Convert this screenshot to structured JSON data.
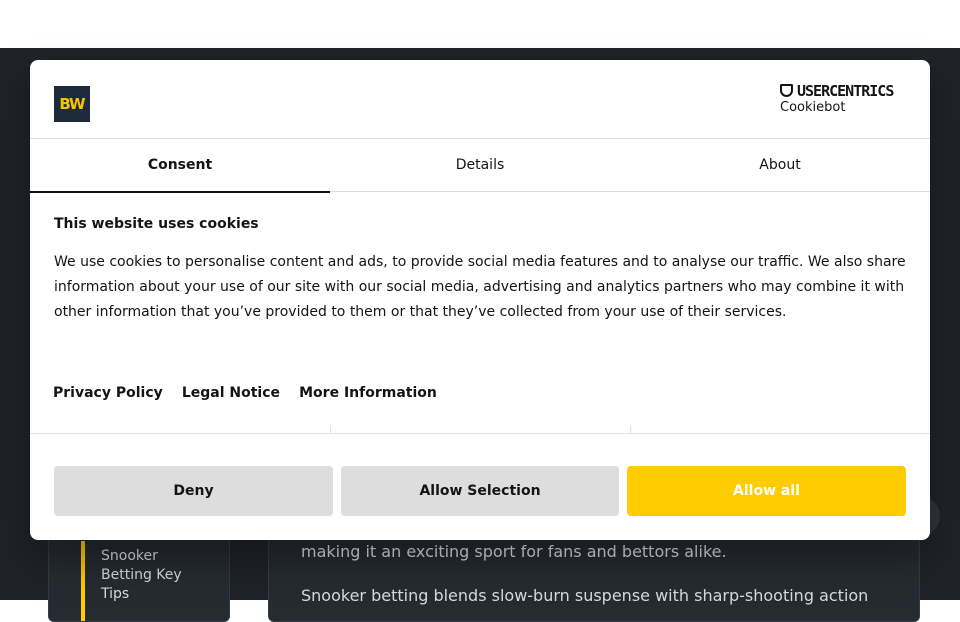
{
  "background": {
    "sidebar_link": "Snooker Betting Key Tips",
    "article_lines": [
      "making it an exciting sport for fans and bettors alike.",
      "Snooker betting blends slow-burn suspense with sharp-shooting action"
    ]
  },
  "dialog": {
    "logo_text": "BW",
    "brand": {
      "name": "USERCENTRICS",
      "sub": "Cookiebot"
    },
    "tabs": [
      {
        "label": "Consent"
      },
      {
        "label": "Details"
      },
      {
        "label": "About"
      }
    ],
    "title": "This website uses cookies",
    "body": "We use cookies to personalise content and ads, to provide social media features and to analyse our traffic. We also share information about your use of our site with our social media, advertising and analytics partners who may combine it with other information that you’ve provided to them or that they’ve collected from your use of their services.",
    "links": {
      "privacy": "Privacy Policy",
      "legal": "Legal Notice",
      "more": "More Information"
    },
    "buttons": {
      "deny": "Deny",
      "allow_selection": "Allow Selection",
      "allow_all": "Allow all"
    }
  },
  "colors": {
    "accent": "#ffcc00",
    "backdrop": "#1f2329"
  }
}
